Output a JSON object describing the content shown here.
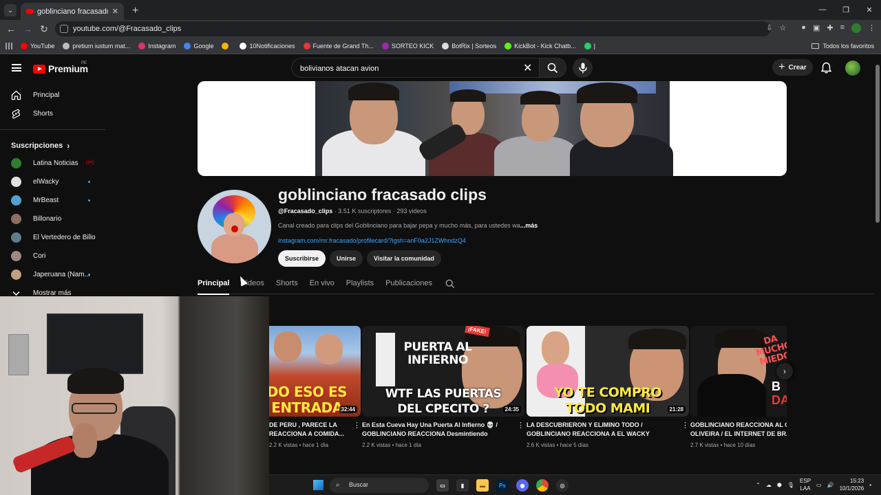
{
  "browser": {
    "tab_title": "goblinciano fracasado clips - Yo",
    "url": "youtube.com/@Fracasado_clips",
    "bookmarks": [
      {
        "label": "YouTube",
        "color": "#ff0000"
      },
      {
        "label": "pretium iustum mat...",
        "color": "#bbbbbb"
      },
      {
        "label": "Instagram",
        "color": "#e1306c"
      },
      {
        "label": "Google",
        "color": "#4285f4"
      },
      {
        "label": "",
        "color": "#f4b400"
      },
      {
        "label": "10Notificaciones",
        "color": "#ffffff"
      },
      {
        "label": "Fuente de Grand Th...",
        "color": "#e53935"
      },
      {
        "label": "SORTEO KICK",
        "color": "#9c27b0"
      },
      {
        "label": "BotRix | Sorteos",
        "color": "#dddddd"
      },
      {
        "label": "KickBot - Kick Chatb...",
        "color": "#53fc18"
      },
      {
        "label": "|",
        "color": "#25d366"
      }
    ],
    "all_favorites": "Todos los favoritos"
  },
  "header": {
    "logo_text": "Premium",
    "logo_country": "PE",
    "search_value": "bolivianos atacan avion",
    "create_label": "Crear"
  },
  "sidebar": {
    "items": [
      {
        "label": "Principal",
        "icon": "home-icon"
      },
      {
        "label": "Shorts",
        "icon": "shorts-icon"
      }
    ],
    "subscriptions_title": "Suscripciones",
    "channels": [
      {
        "label": "Latina Noticias",
        "color": "#2e7d32",
        "status": "live"
      },
      {
        "label": "elWacky",
        "color": "#e0e0e0",
        "status": "new"
      },
      {
        "label": "MrBeast",
        "color": "#4fa3d1",
        "status": "new"
      },
      {
        "label": "Billonario",
        "color": "#8d6e63",
        "status": ""
      },
      {
        "label": "El Vertedero de Billo",
        "color": "#607d8b",
        "status": ""
      },
      {
        "label": "Cori",
        "color": "#a1887f",
        "status": ""
      },
      {
        "label": "Japeruana (Nam...",
        "color": "#c0a080",
        "status": "new"
      }
    ],
    "show_more": "Mostrar más",
    "live_mark": "((•))"
  },
  "channel": {
    "name": "goblinciano fracasado clips",
    "handle": "@Fracasado_clips",
    "stats": " · 3.51 K suscriptores · 293 videos",
    "description": "Canal creado para clips del Goblinciano para bajar pepa y mucho más,  para ustedes wa",
    "more": "...más",
    "link": "instagram.com/mr.fracasado/profilecard/?igsh=anF0a2J1ZWhndzQ4",
    "buttons": {
      "subscribe": "Suscribirse",
      "join": "Unirse",
      "community": "Visitar la comunidad"
    },
    "tabs": [
      "Principal",
      "Videos",
      "Shorts",
      "En vivo",
      "Playlists",
      "Publicaciones"
    ]
  },
  "videos": [
    {
      "title": "DE PERU , PARECE LA\nREACCIONA A COMIDA...",
      "meta": "2.2 K vistas • hace 1 día",
      "duration": "32:44",
      "thumb_text": "DO ESO ES\nENTRADA",
      "thumb_color": "#c0492b"
    },
    {
      "title": "En Esta Cueva Hay Una Puerta Al Infierno 💀 /\nGOBLINCIANO REACCIONA Desmintiendo Videos...",
      "meta": "2.2 K vistas • hace 1 día",
      "duration": "24:35",
      "thumb_text": "WTF LAS PUERTAS\nDEL CPECITO ?",
      "thumb_top": "PUERTA AL\nINFIERNO",
      "thumb_color": "#1c1c1c"
    },
    {
      "title": "LA DESCUBRIERON Y ELIMINO TODO /\nGOBLINCIANO REACCIONA A EL WACKY",
      "meta": "2.6 K vistas • hace 5 días",
      "duration": "21:28",
      "thumb_text": "YO TE COMPRO\nTODO MAMI",
      "thumb_color": "#2a2a2a"
    },
    {
      "title": "GOBLINCIANO REACCIONA AL CA\nOLIVEIRA / EL INTERNET DE BRAS",
      "meta": "2.7 K vistas • hace 10 días",
      "duration": "",
      "thumb_text": "DA\nMUCHO\nMIEDO",
      "thumb_color": "#181818"
    }
  ],
  "taskbar": {
    "search": "Buscar",
    "lang1": "ESP",
    "lang2": "LAA",
    "time": "15:23",
    "date": "10/1/2026"
  }
}
